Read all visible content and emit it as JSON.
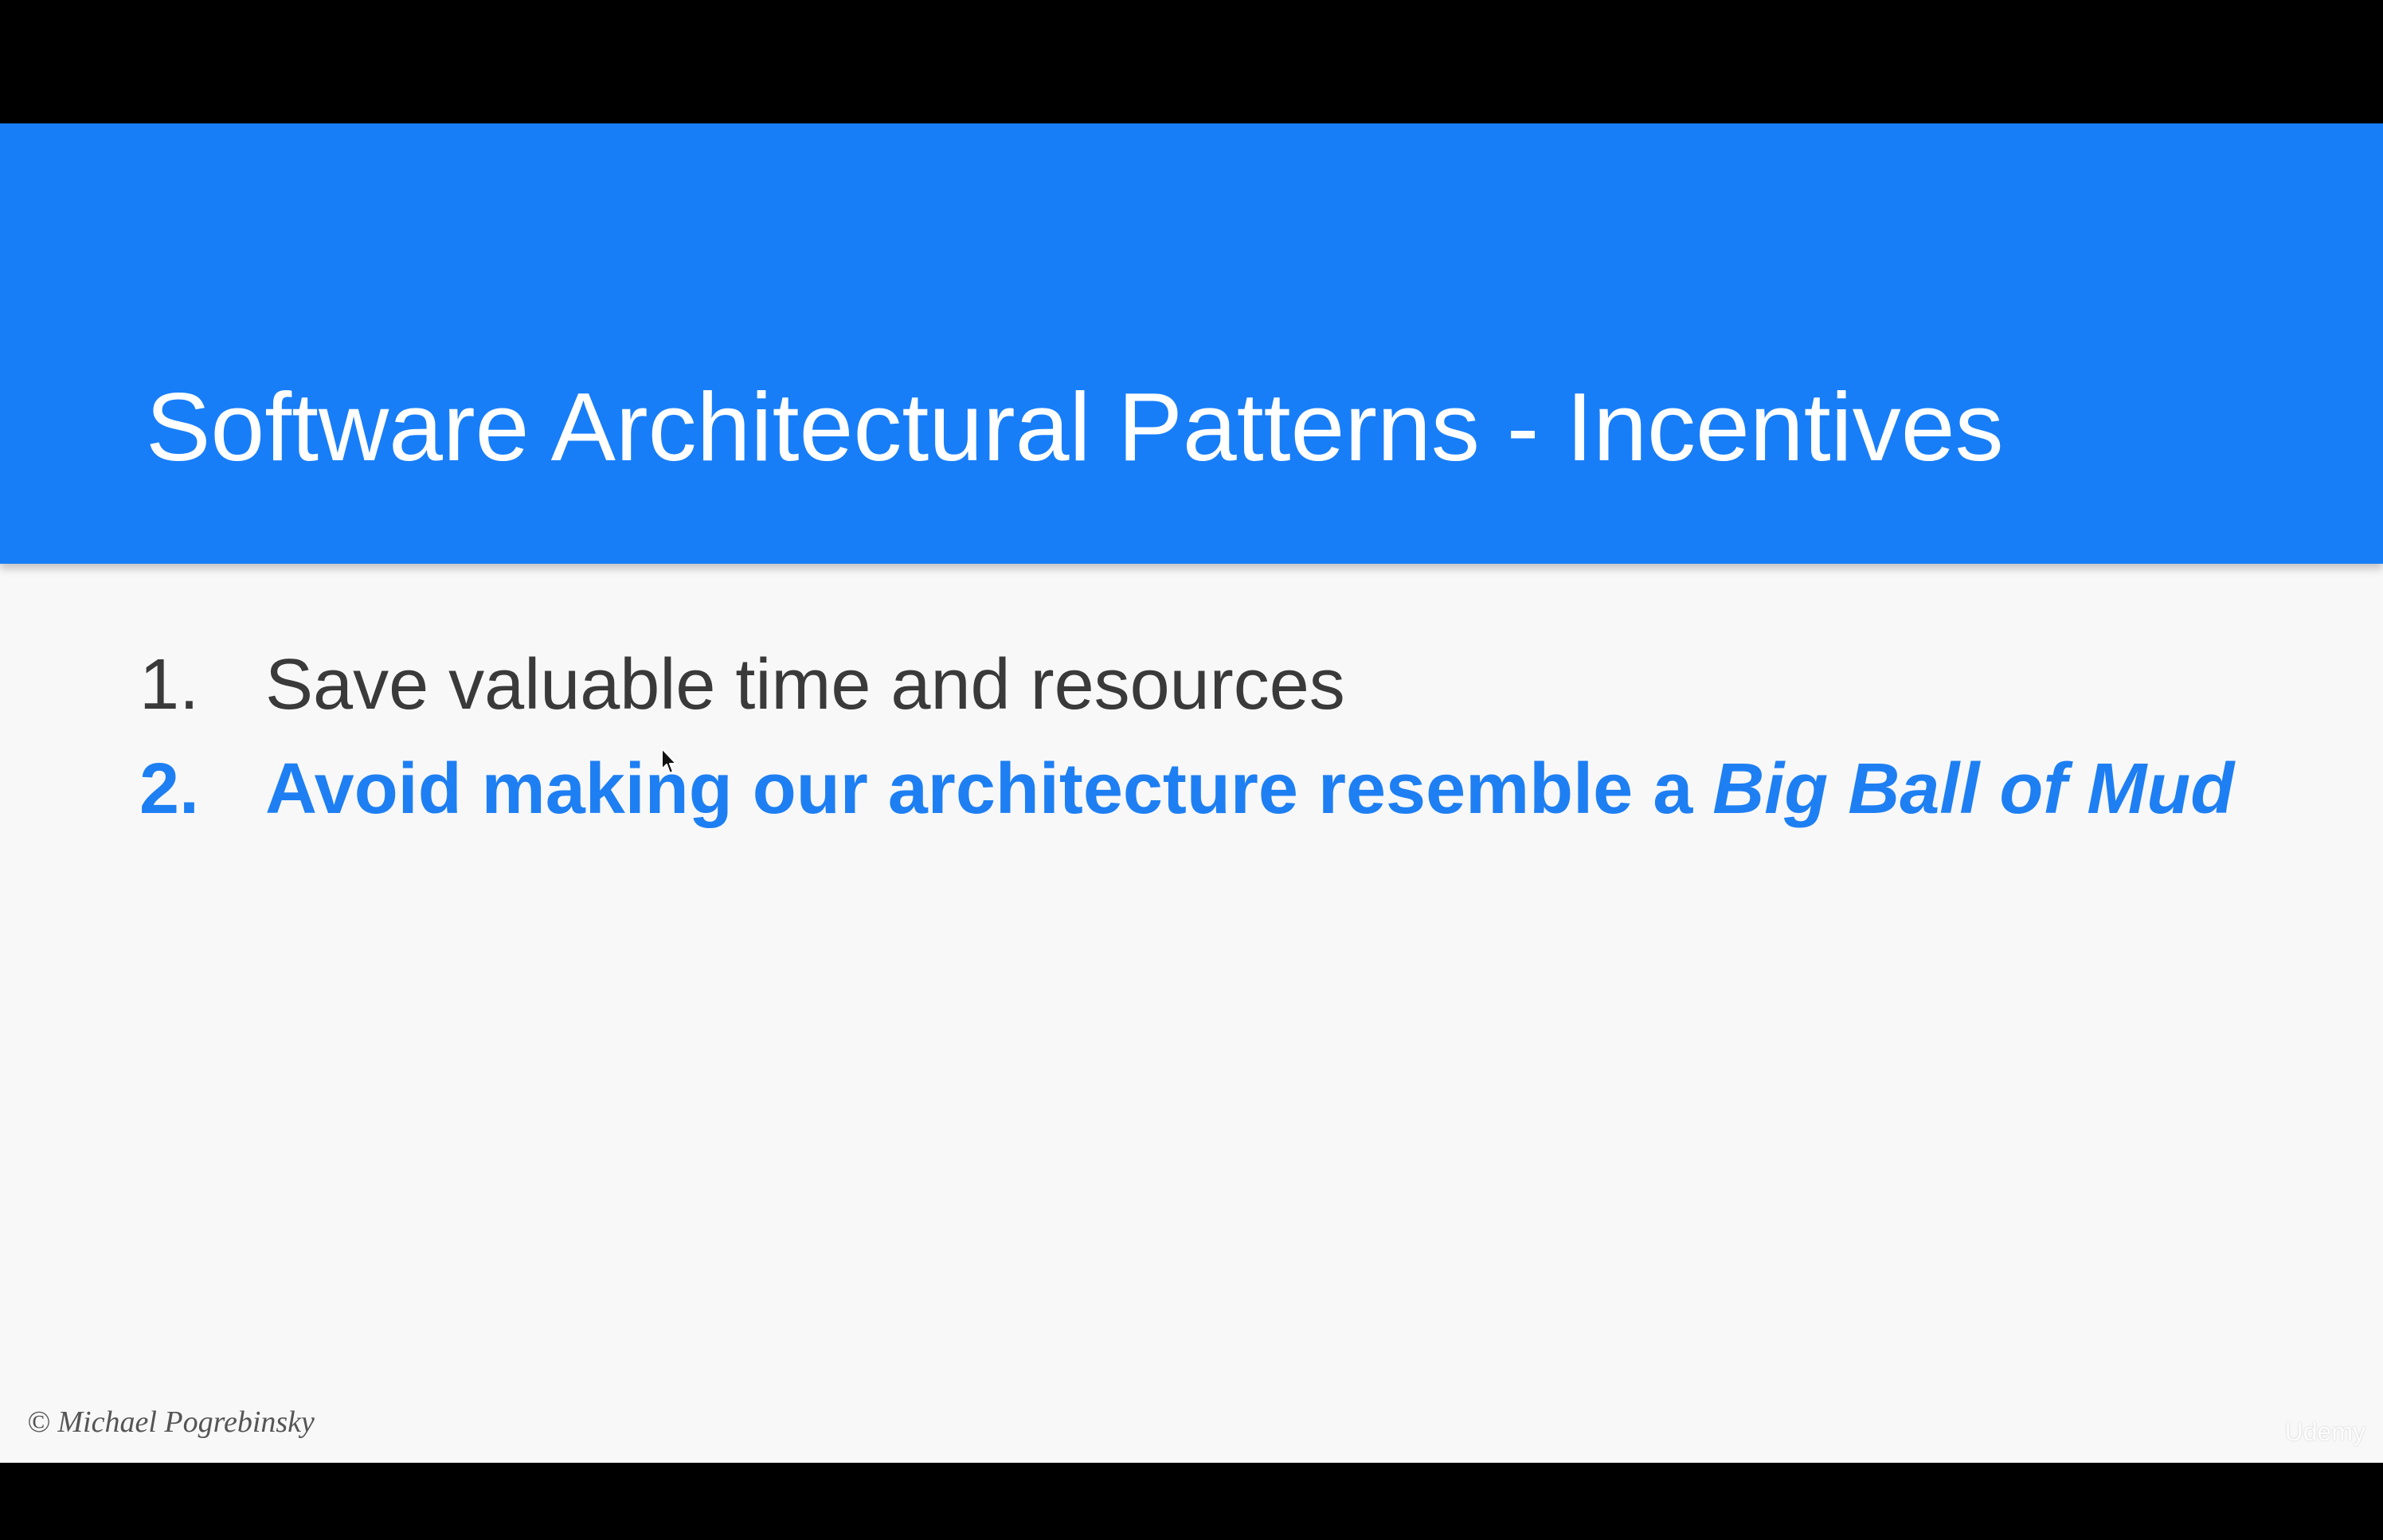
{
  "slide": {
    "title": "Software Architectural Patterns - Incentives",
    "items": [
      {
        "number": "1.",
        "text": "Save valuable time and resources"
      },
      {
        "number": "2.",
        "text": "Avoid making our architecture resemble a ",
        "emphasis": "Big Ball of Mud"
      }
    ],
    "copyright": "© Michael Pogrebinsky"
  },
  "watermark": "Udemy",
  "colors": {
    "header": "#187ef8",
    "background": "#f8f8f8",
    "highlight": "#1e7ff3",
    "text": "#3a3a3a"
  }
}
